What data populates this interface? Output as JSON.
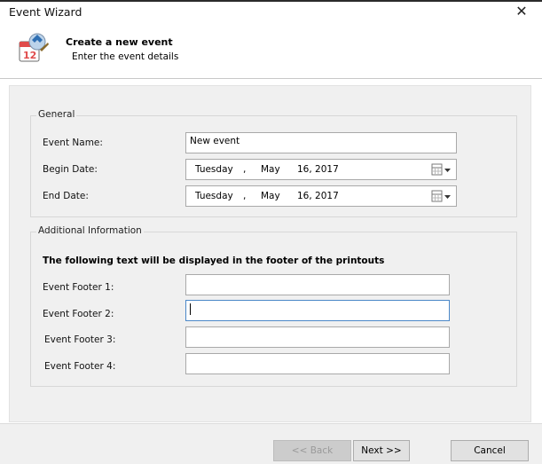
{
  "window": {
    "title": "Event Wizard",
    "close_glyph": "✕"
  },
  "header": {
    "title": "Create a new event",
    "subtitle": "Enter the event details",
    "icon": "calendar-wizard-icon"
  },
  "general": {
    "legend": "General",
    "event_name_label": "Event Name:",
    "event_name_value": "New event",
    "begin_date_label": "Begin Date:",
    "begin_date": {
      "weekday": "Tuesday",
      "sep1": ",",
      "month": "May",
      "day_year": "16, 2017"
    },
    "end_date_label": "End Date:",
    "end_date": {
      "weekday": "Tuesday",
      "sep1": ",",
      "month": "May",
      "day_year": "16, 2017"
    }
  },
  "additional": {
    "legend": "Additional Information",
    "note": "The following text will be displayed in the footer of the printouts",
    "footer1_label": "Event Footer 1:",
    "footer2_label": "Event Footer 2:",
    "footer3_label": "Event Footer 3:",
    "footer4_label": "Event Footer 4:",
    "footer1_value": "",
    "footer2_value": "",
    "footer3_value": "",
    "footer4_value": ""
  },
  "buttons": {
    "back": "<< Back",
    "next": "Next >>",
    "cancel": "Cancel"
  },
  "colors": {
    "panel": "#f0f0f0",
    "focus_border": "#4b88c8",
    "disabled_button": "#cccccc"
  }
}
